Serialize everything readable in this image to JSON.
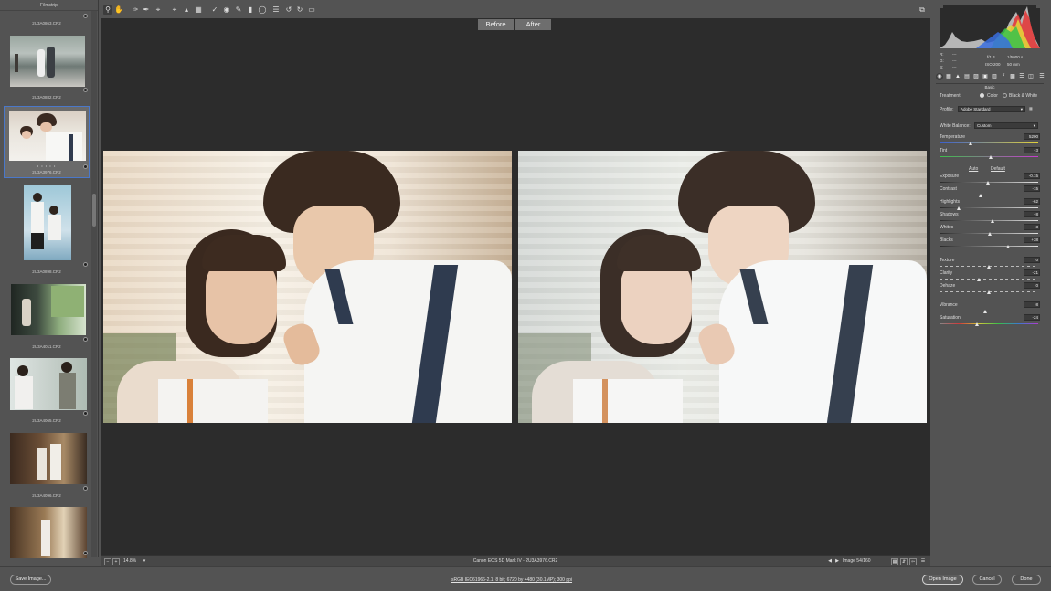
{
  "filmstrip": {
    "title": "Filmstrip",
    "items": [
      {
        "file": "2U3A0863.CR2",
        "stars": ""
      },
      {
        "file": "2U3A0882.CR2",
        "stars": ""
      },
      {
        "file": "2U3A3976.CR2",
        "stars": "• • • • •"
      },
      {
        "file": "2U3A0898.CR2",
        "stars": ""
      },
      {
        "file": "2U3A4011.CR2",
        "stars": ""
      },
      {
        "file": "2U3A4065.CR2",
        "stars": ""
      },
      {
        "file": "2U3A4096.CR2",
        "stars": ""
      },
      {
        "file": "",
        "stars": ""
      }
    ]
  },
  "toolbar": {
    "tools": [
      "zoom-icon",
      "hand-icon",
      "white-balance-icon",
      "color-sampler-icon",
      "targeted-adjustment-icon",
      "crop-icon",
      "straighten-icon",
      "transform-icon",
      "spot-removal-icon",
      "red-eye-icon",
      "adjustment-brush-icon",
      "graduated-filter-icon",
      "radial-filter-icon",
      "preferences-icon",
      "rotate-left-icon",
      "rotate-right-icon",
      "trash-icon"
    ],
    "fullscreen_icon": "fullscreen-icon"
  },
  "preview": {
    "before_label": "Before",
    "after_label": "After"
  },
  "status": {
    "zoom": "14.8%",
    "camera": "Canon EOS 5D Mark IV  -  2U3A3976.CR2",
    "image_counter": "Image 54/160"
  },
  "histogram": {
    "r_label": "R:",
    "g_label": "G:",
    "b_label": "B:",
    "r_value": "---",
    "g_value": "---",
    "b_value": "---",
    "aperture": "f/1.4",
    "shutter": "1/5000 s",
    "iso": "ISO 200",
    "focal": "50 mm"
  },
  "panel": {
    "title": "Basic",
    "treatment_label": "Treatment:",
    "treatment_color": "Color",
    "treatment_bw": "Black & White",
    "profile_label": "Profile:",
    "profile_value": "Adobe Standard",
    "wb_label": "White Balance:",
    "wb_value": "Custom",
    "temperature_label": "Temperature",
    "temperature_value": "5200",
    "tint_label": "Tint",
    "tint_value": "+3",
    "auto_label": "Auto",
    "default_label": "Default",
    "sliders": [
      {
        "label": "Exposure",
        "value": "-0.15",
        "pos": 0.49
      },
      {
        "label": "Contrast",
        "value": "-15",
        "pos": 0.42
      },
      {
        "label": "Highlights",
        "value": "-62",
        "pos": 0.19
      },
      {
        "label": "Shadows",
        "value": "+8",
        "pos": 0.54
      },
      {
        "label": "Whites",
        "value": "+3",
        "pos": 0.51
      },
      {
        "label": "Blacks",
        "value": "+38",
        "pos": 0.69
      },
      {
        "label": "Texture",
        "value": "0",
        "pos": 0.5
      },
      {
        "label": "Clarity",
        "value": "-21",
        "pos": 0.4
      },
      {
        "label": "Dehaze",
        "value": "0",
        "pos": 0.5
      },
      {
        "label": "Vibrance",
        "value": "-8",
        "pos": 0.46
      },
      {
        "label": "Saturation",
        "value": "-24",
        "pos": 0.38
      }
    ]
  },
  "bottom": {
    "save_label": "Save Image...",
    "workflow": "sRGB IEC61966-2.1; 8 bit; 6720 by 4480 (30.1MP); 300 ppi",
    "open_label": "Open Image",
    "cancel_label": "Cancel",
    "done_label": "Done"
  },
  "colors": {
    "accent": "#4b78c9",
    "panel": "#535353",
    "preview": "#2c2c2c"
  }
}
